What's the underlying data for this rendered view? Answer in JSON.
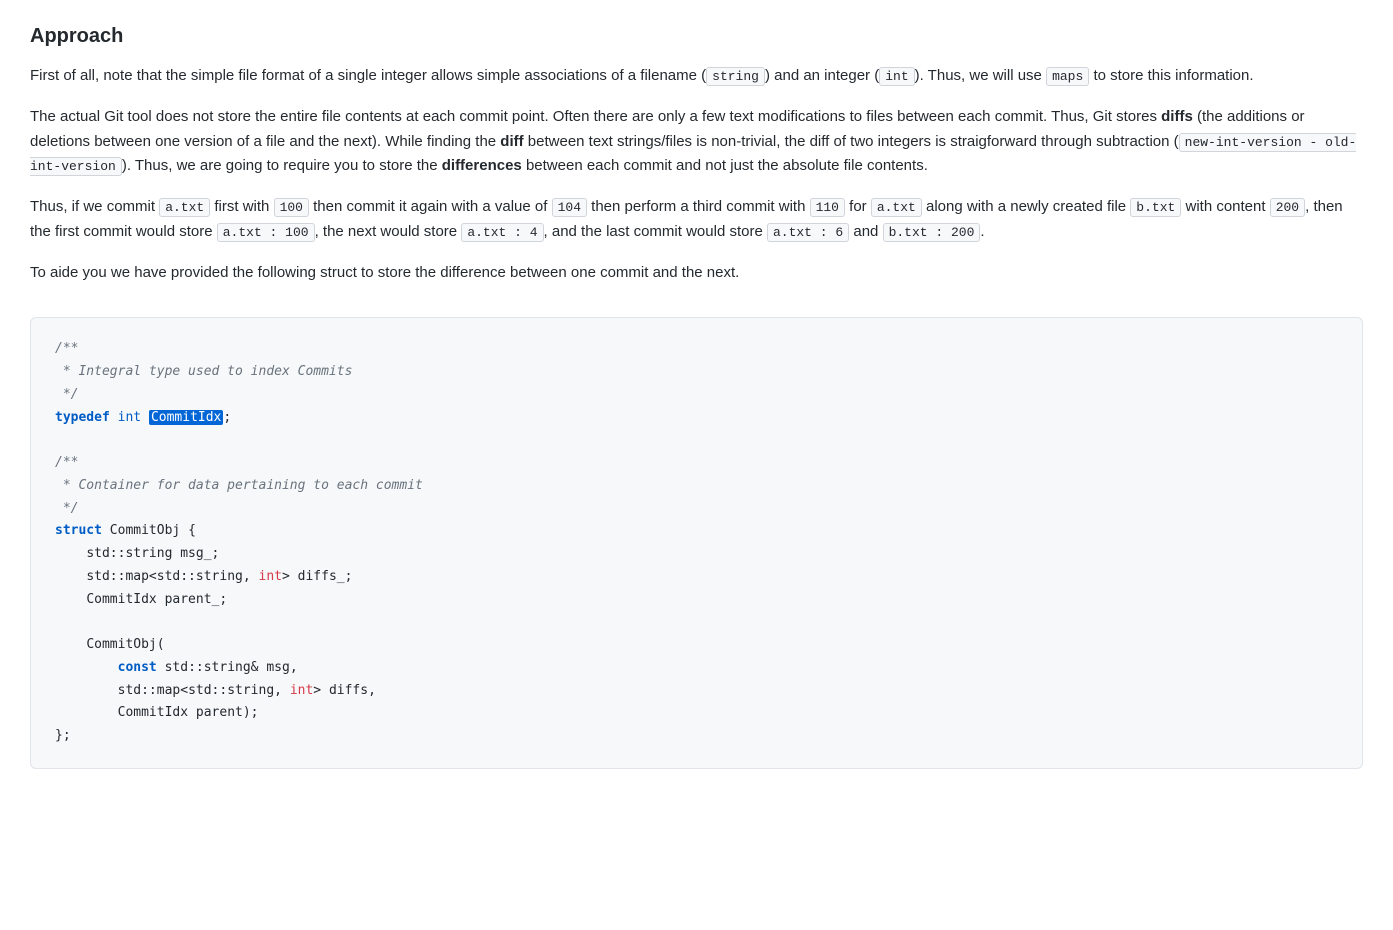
{
  "heading": "Approach",
  "paragraph1": {
    "text_parts": [
      "First of all, note that the simple file format of a single integer allows simple associations of a filename (",
      "string",
      ") and an integer (",
      "int",
      "). Thus, we will use ",
      "maps",
      " to store this information."
    ]
  },
  "paragraph2": {
    "text_parts": [
      "The actual Git tool does not store the entire file contents at each commit point. Often there are only a few text modifications to files between each commit. Thus, Git stores ",
      "diffs",
      " (the additions or deletions between one version of a file and the next). While finding the ",
      "diff",
      " between text strings/files is non-trivial, the diff of two integers is straigforward through subtraction (",
      "new-int-version - old-int-version",
      "). Thus, we are going to require you to store the ",
      "differences",
      " between each commit and not just the absolute file contents."
    ]
  },
  "paragraph3": {
    "text_parts": [
      "Thus, if we commit ",
      "a.txt",
      " first with ",
      "100",
      " then commit it again with a value of ",
      "104",
      " then perform a third commit with ",
      "110",
      " for ",
      "a.txt",
      " along with a newly created file ",
      "b.txt",
      " with content ",
      "200",
      ", then the first commit would store ",
      "a.txt : 100",
      ", the next would store ",
      "a.txt : 4",
      ", and the last commit would store ",
      "a.txt : 6",
      " and ",
      "b.txt : 200",
      "."
    ]
  },
  "paragraph4": "To aide you we have provided the following struct to store the difference between one commit and the next.",
  "code": {
    "lines": [
      {
        "type": "comment",
        "text": "/**"
      },
      {
        "type": "comment",
        "text": " * Integral type used to index Commits"
      },
      {
        "type": "comment",
        "text": " */"
      },
      {
        "type": "typedef",
        "text": "typedef int CommitIdx;"
      },
      {
        "type": "blank",
        "text": ""
      },
      {
        "type": "comment",
        "text": "/**"
      },
      {
        "type": "comment",
        "text": " * Container for data pertaining to each commit"
      },
      {
        "type": "comment",
        "text": " */"
      },
      {
        "type": "struct_def",
        "text": "struct CommitObj {"
      },
      {
        "type": "member",
        "text": "    std::string msg_;"
      },
      {
        "type": "member_int",
        "text": "    std::map<std::string, int> diffs_;"
      },
      {
        "type": "member",
        "text": "    CommitIdx parent_;"
      },
      {
        "type": "blank",
        "text": ""
      },
      {
        "type": "constructor",
        "text": "    CommitObj("
      },
      {
        "type": "param",
        "text": "        const std::string& msg,"
      },
      {
        "type": "param_int",
        "text": "        std::map<std::string, int> diffs,"
      },
      {
        "type": "param",
        "text": "        CommitIdx parent);"
      },
      {
        "type": "close",
        "text": "};"
      }
    ]
  }
}
